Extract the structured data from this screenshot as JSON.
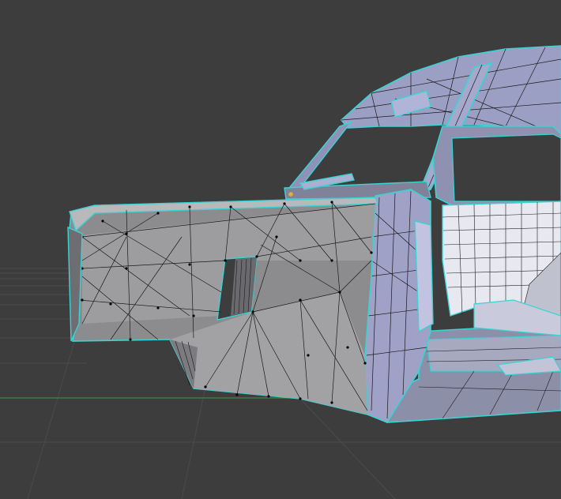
{
  "app": {
    "name": "3D viewport"
  },
  "viewport": {
    "mode": "edit-mode-wireframe",
    "background_color": "#3d3d3d",
    "grid_color": "#4a4a4a",
    "x_axis_color": "#3a8a3a",
    "selection_edge_color": "#3cd6d6",
    "vertex_color": "#000000",
    "active_vertex_color": "#e0b030"
  },
  "scene": {
    "object": "car-body-mesh",
    "parts": [
      "front-bumper",
      "wheel-arch-cutout",
      "a-pillar",
      "windshield-frame",
      "roof",
      "door-opening",
      "interior-seat",
      "side-mirror",
      "wiper"
    ]
  }
}
